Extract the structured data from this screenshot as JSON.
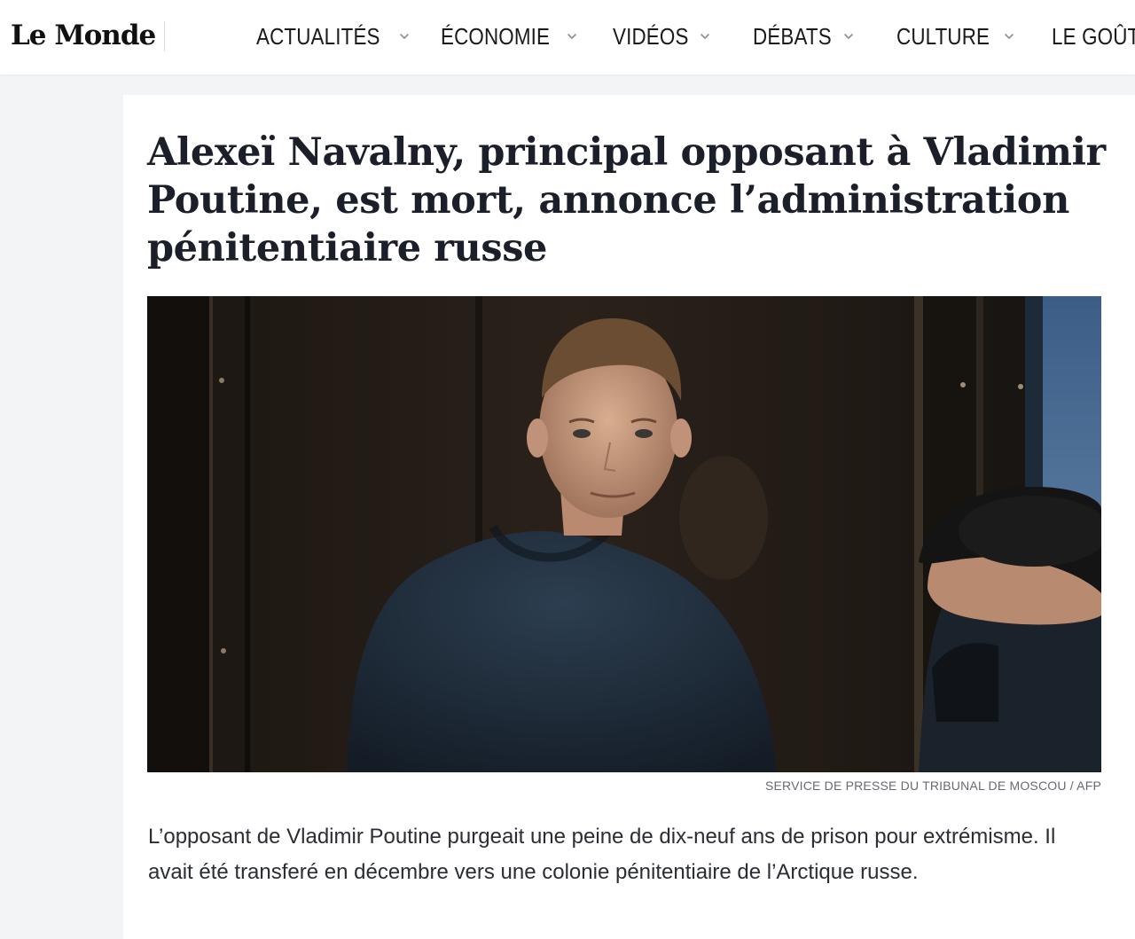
{
  "header": {
    "logo": "Le Monde",
    "nav": [
      {
        "label": "ACTUALITÉS",
        "has_dropdown": true
      },
      {
        "label": "ÉCONOMIE",
        "has_dropdown": true
      },
      {
        "label": "VIDÉOS",
        "has_dropdown": true
      },
      {
        "label": "DÉBATS",
        "has_dropdown": true
      },
      {
        "label": "CULTURE",
        "has_dropdown": true
      },
      {
        "label": "LE GOÛT",
        "has_dropdown": false
      }
    ],
    "dropdown_icon": "chevron-down-icon"
  },
  "article": {
    "headline": "Alexeï Navalny, principal opposant à Vladimir Poutine, est mort, annonce l’administration pénitentiaire russe",
    "photo_credit": "SERVICE DE PRESSE DU TRIBUNAL DE MOSCOU / AFP",
    "lead": "L’opposant de Vladimir Poutine purgeait une peine de dix-neuf ans de prison pour extrémisme. Il avait été transferé en décembre vers une colonie pénitentiaire de l’Arctique russe."
  },
  "colors": {
    "page_bg": "#f3f4f6",
    "header_bg": "#ffffff",
    "headline": "#1b1f2a",
    "body_text": "#2a2d33",
    "credit_text": "#666a70"
  }
}
